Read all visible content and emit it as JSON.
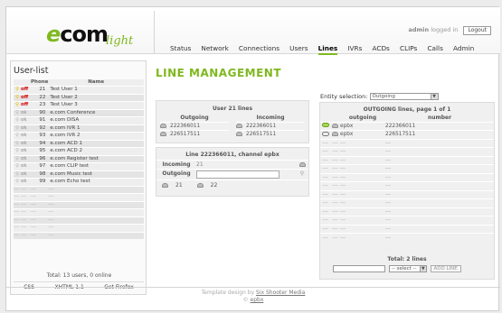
{
  "logo": {
    "e": "e",
    "com": "com",
    "light": "light"
  },
  "header": {
    "user": "admin",
    "logged_in_text": "logged in",
    "logout_label": "Logout"
  },
  "nav": [
    "Status",
    "Network",
    "Connections",
    "Users",
    "Lines",
    "IVRs",
    "ACDs",
    "CLIPs",
    "Calls",
    "Admin"
  ],
  "nav_active": "Lines",
  "sidebar": {
    "title": "User-list",
    "columns": [
      "Phone",
      "Name"
    ],
    "users": [
      {
        "status": "off",
        "phone": "21",
        "name": "Test User 1"
      },
      {
        "status": "off",
        "phone": "22",
        "name": "Test User 2"
      },
      {
        "status": "off",
        "phone": "23",
        "name": "Test User 3"
      },
      {
        "status": "ok",
        "phone": "90",
        "name": "e.com Conference"
      },
      {
        "status": "ok",
        "phone": "91",
        "name": "e.com DISA"
      },
      {
        "status": "ok",
        "phone": "92",
        "name": "e.com IVR 1"
      },
      {
        "status": "ok",
        "phone": "93",
        "name": "e.com IVR 2"
      },
      {
        "status": "ok",
        "phone": "94",
        "name": "e.com ACD 1"
      },
      {
        "status": "ok",
        "phone": "95",
        "name": "e.com ACD 2"
      },
      {
        "status": "ok",
        "phone": "96",
        "name": "e.com Register test"
      },
      {
        "status": "ok",
        "phone": "97",
        "name": "e.com CLIP test"
      },
      {
        "status": "ok",
        "phone": "98",
        "name": "e.com Music test"
      },
      {
        "status": "ok",
        "phone": "99",
        "name": "e.com Echo test"
      }
    ],
    "empty_rows": 7,
    "empty_cell": "---",
    "total": "Total: 13 users, 0 online",
    "links": [
      "CSS",
      "XHTML 1.1",
      "Get Firefox"
    ]
  },
  "main": {
    "title": "LINE MANAGEMENT",
    "user_lines": {
      "title": "User 21 lines",
      "outgoing_header": "Outgoing",
      "incoming_header": "Incoming",
      "outgoing": [
        "222366011",
        "226517511"
      ],
      "incoming": [
        "222366011",
        "226517511"
      ]
    },
    "line_detail": {
      "title": "Line 222366011, channel epbx",
      "incoming_label": "Incoming",
      "incoming_value": "21",
      "outgoing_label": "Outgoing",
      "chips": [
        "21",
        "22"
      ]
    }
  },
  "entity": {
    "label": "Entity selection:",
    "selected": "Outgoing",
    "panel_title": "OUTGOING lines, page 1 of 1",
    "col_outgoing": "outgoing",
    "col_number": "number",
    "rows": [
      {
        "active": true,
        "name": "epbx",
        "number": "222366011"
      },
      {
        "active": false,
        "name": "epbx",
        "number": "226517511"
      }
    ],
    "empty_rows": 12,
    "empty_cell": "---",
    "total": "Total: 2 lines",
    "select_placeholder": "-- select --",
    "add_label": "ADD LINE"
  },
  "footer": {
    "line1_prefix": "Template design by",
    "line1_link": "Six Shooter Media",
    "line2_prefix": "©",
    "line2_link": "epbx"
  }
}
